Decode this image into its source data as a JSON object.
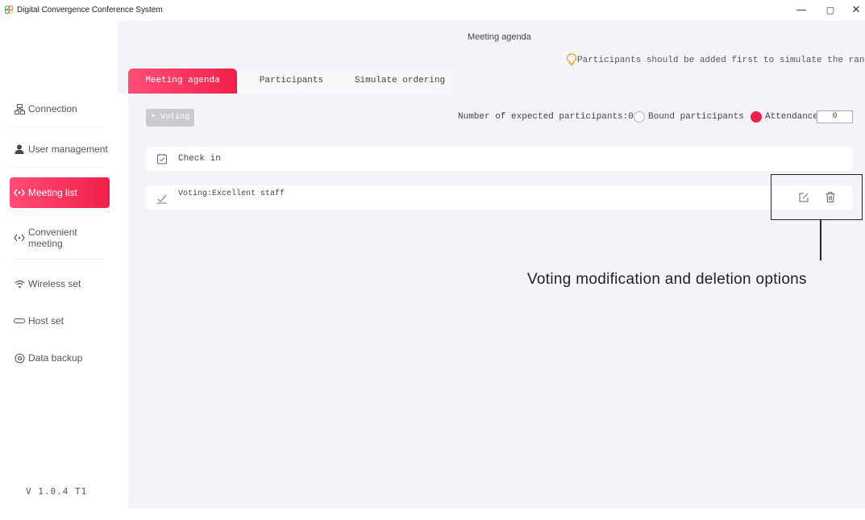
{
  "window": {
    "title": "Digital Convergence Conference System",
    "controls": {
      "minimize": "—",
      "maximize": "▢",
      "close": "✕"
    }
  },
  "sidebar": {
    "items": [
      {
        "label": "Connection",
        "icon": "connection-icon",
        "active": false
      },
      {
        "label": "User management",
        "icon": "user-icon",
        "active": false
      },
      {
        "label": "Meeting list",
        "icon": "meeting-list-icon",
        "active": true
      },
      {
        "label": "Convenient meeting",
        "icon": "convenient-meeting-icon",
        "active": false
      },
      {
        "label": "Wireless set",
        "icon": "wifi-icon",
        "active": false
      },
      {
        "label": "Host set",
        "icon": "host-icon",
        "active": false
      },
      {
        "label": "Data backup",
        "icon": "backup-icon",
        "active": false
      }
    ],
    "version": "V 1.0.4 T1"
  },
  "main": {
    "heading": "Meeting agenda",
    "hint": "Participants should be added first to simulate the ranking",
    "tabs": [
      {
        "label": "Meeting agenda",
        "active": true
      },
      {
        "label": "Participants",
        "active": false
      },
      {
        "label": "Simulate ordering",
        "active": false
      }
    ],
    "voting_button": "+ Voting",
    "expected_participants": "Number of expected participants:0",
    "radio_bound": "Bound participants",
    "radio_attendance": "Attendance",
    "attendance_value": "0",
    "rows": [
      {
        "label": "Check in",
        "icon": "checkin-icon"
      },
      {
        "label": "Voting:Excellent staff",
        "icon": "voting-icon"
      }
    ]
  },
  "annotation": {
    "text": "Voting modification and deletion options"
  },
  "colors": {
    "accent": "#f1204a",
    "panel": "#f3f4f7",
    "disabled_button": "#c9cbd0"
  }
}
